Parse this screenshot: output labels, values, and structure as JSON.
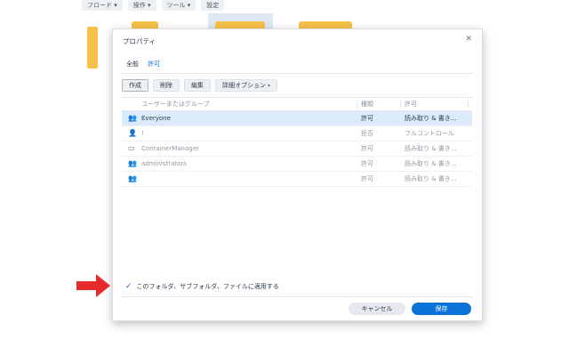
{
  "background": {
    "toolbar": [
      "フロード ▾",
      "操作 ▾",
      "ツール ▾",
      "設定"
    ]
  },
  "dialog": {
    "title": "プロパティ",
    "close_icon": "close-icon",
    "tabs": [
      {
        "label": "全般",
        "active": false
      },
      {
        "label": "許可",
        "active": true
      }
    ],
    "toolbar": {
      "create": "作成",
      "delete": "削除",
      "edit": "編集",
      "advanced": "詳細オプション"
    },
    "table": {
      "headers": {
        "name": "ユーザーまたはグループ",
        "type": "種類",
        "permission": "許可",
        "menu": "⋮"
      },
      "rows": [
        {
          "icon": "group-icon",
          "name": "Everyone",
          "type": "許可",
          "permission": "読み取り & 書き...",
          "selected": true
        },
        {
          "icon": "user-icon",
          "name": "!",
          "type": "拒否",
          "permission": "フルコントロール",
          "selected": false
        },
        {
          "icon": "app-icon",
          "name": "ContainerManager",
          "type": "許可",
          "permission": "読み取り & 書き...",
          "selected": false
        },
        {
          "icon": "group-icon",
          "name": "administrators",
          "type": "許可",
          "permission": "読み取り & 書き...",
          "selected": false
        },
        {
          "icon": "group-icon",
          "name": "",
          "type": "許可",
          "permission": "読み取り & 書き...",
          "selected": false
        }
      ]
    },
    "apply_all": {
      "label": "このフォルダ、サブフォルダ、ファイルに適用する",
      "checked": true
    },
    "footer": {
      "cancel": "キャンセル",
      "save": "保存"
    }
  },
  "colors": {
    "accent": "#0b72d8",
    "arrow": "#e52b2b",
    "folder": "#f6c24a"
  }
}
